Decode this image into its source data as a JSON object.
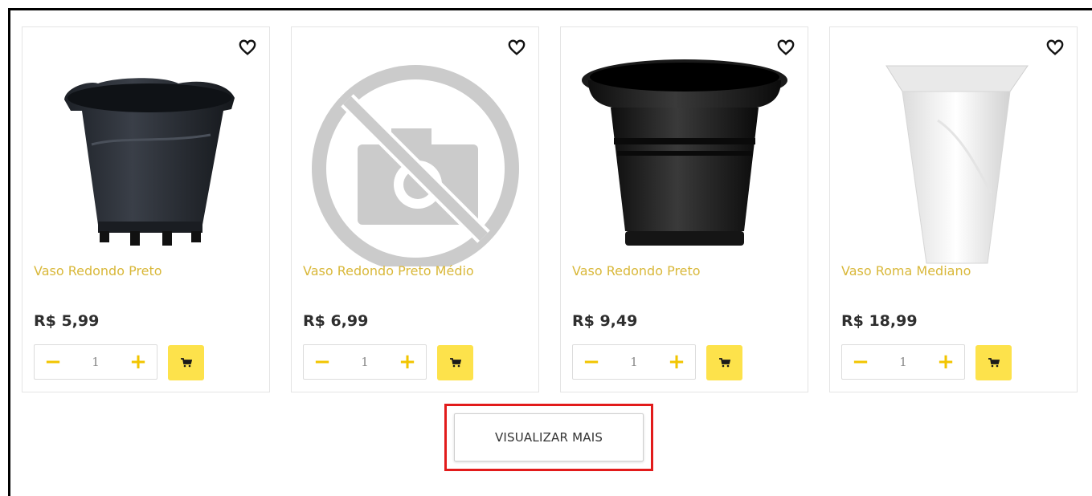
{
  "products": [
    {
      "name": "Vaso Redondo Preto",
      "price": "R$ 5,99",
      "quantity": "1",
      "image": "black-round-pot-small"
    },
    {
      "name": "Vaso Redondo Preto Médio",
      "price": "R$ 6,99",
      "quantity": "1",
      "image": "no-image-placeholder"
    },
    {
      "name": "Vaso Redondo Preto",
      "price": "R$ 9,49",
      "quantity": "1",
      "image": "black-round-pot-large"
    },
    {
      "name": "Vaso Roma Mediano",
      "price": "R$ 18,99",
      "quantity": "1",
      "image": "white-square-pot"
    }
  ],
  "controls": {
    "minus": "−",
    "plus": "+"
  },
  "view_more_label": "VISUALIZAR MAIS",
  "colors": {
    "name": "#d9b83a",
    "accent": "#f2c500",
    "cart_button": "#fde24b",
    "highlight": "#e21b1b"
  },
  "icons": {
    "favorite": "heart-icon",
    "cart": "cart-icon"
  }
}
